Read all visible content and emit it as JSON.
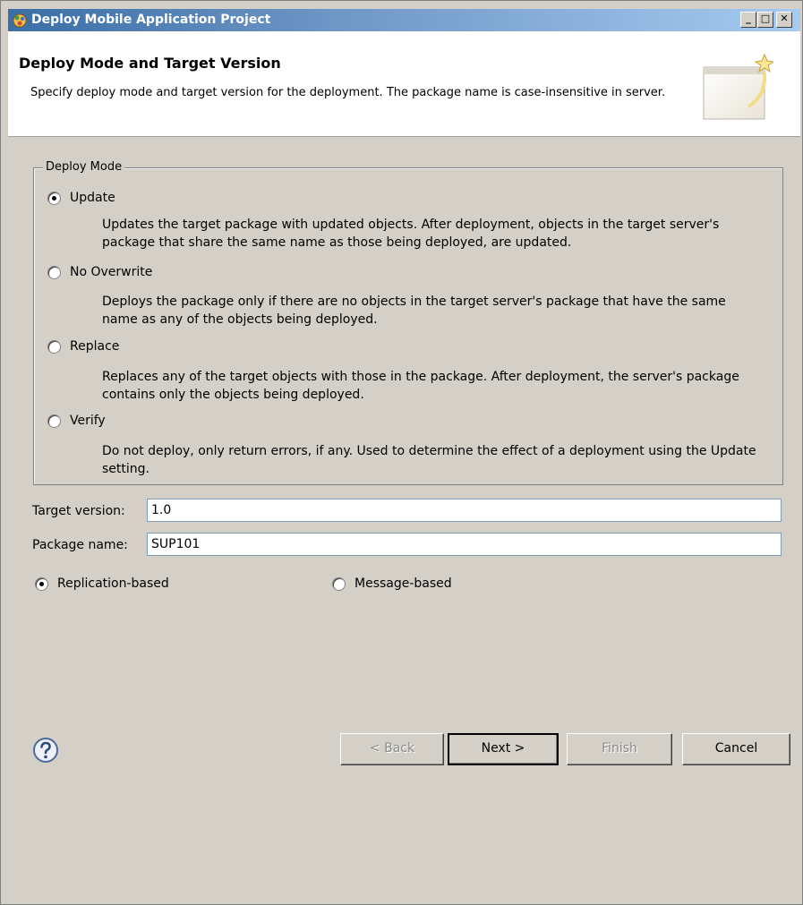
{
  "window": {
    "title": "Deploy Mobile Application Project",
    "buttons": {
      "minimize": "_",
      "maximize": "□",
      "close": "✕"
    }
  },
  "header": {
    "title": "Deploy Mode and Target Version",
    "description": "Specify deploy mode and target version for the deployment. The package name is case-insensitive in server."
  },
  "deploy_mode": {
    "legend": "Deploy Mode",
    "options": [
      {
        "label": "Update",
        "checked": true,
        "description": "Updates the target package with updated objects. After deployment, objects in the target server's package that share the same name as those being deployed, are updated."
      },
      {
        "label": "No Overwrite",
        "checked": false,
        "description": "Deploys the package only if there are no objects in the target server's package that have the same name as any of the objects being deployed."
      },
      {
        "label": "Replace",
        "checked": false,
        "description": "Replaces any of the target objects with those in the package. After deployment, the server's package contains only the objects being deployed."
      },
      {
        "label": "Verify",
        "checked": false,
        "description": "Do not deploy, only return errors, if any. Used to determine the effect of a deployment using the Update setting."
      }
    ]
  },
  "target_version": {
    "label": "Target version:",
    "value": "1.0"
  },
  "package_name": {
    "label": "Package name:",
    "value": "SUP101"
  },
  "sync": {
    "options": [
      {
        "label": "Replication-based",
        "checked": true
      },
      {
        "label": "Message-based",
        "checked": false
      }
    ]
  },
  "footer": {
    "back": "< Back",
    "next": "Next >",
    "finish": "Finish",
    "cancel": "Cancel"
  }
}
